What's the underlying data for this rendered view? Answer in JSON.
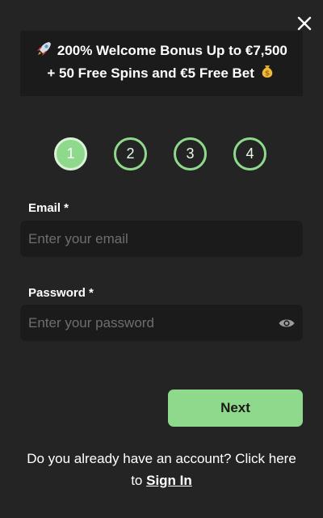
{
  "close": {
    "icon": "close-icon"
  },
  "promo": {
    "leading_icon": "rocket-icon",
    "line1": "200% Welcome Bonus Up to €7,500",
    "line2": "+ 50 Free Spins and €5 Free Bet",
    "trailing_icon": "money-bag-icon"
  },
  "steps": {
    "items": [
      "1",
      "2",
      "3",
      "4"
    ],
    "active_index": 0,
    "accent_color": "#8ed98c"
  },
  "form": {
    "email_label": "Email *",
    "email_value": "",
    "email_placeholder": "Enter your email",
    "password_label": "Password *",
    "password_value": "",
    "password_placeholder": "Enter your password",
    "password_toggle_icon": "eye-icon"
  },
  "actions": {
    "next_label": "Next"
  },
  "footer": {
    "text_before": "Do you already have an account? Click here to ",
    "signin_label": "Sign In"
  },
  "colors": {
    "background": "#242424",
    "field_background": "#1b1b1b",
    "accent": "#8ed98c"
  }
}
